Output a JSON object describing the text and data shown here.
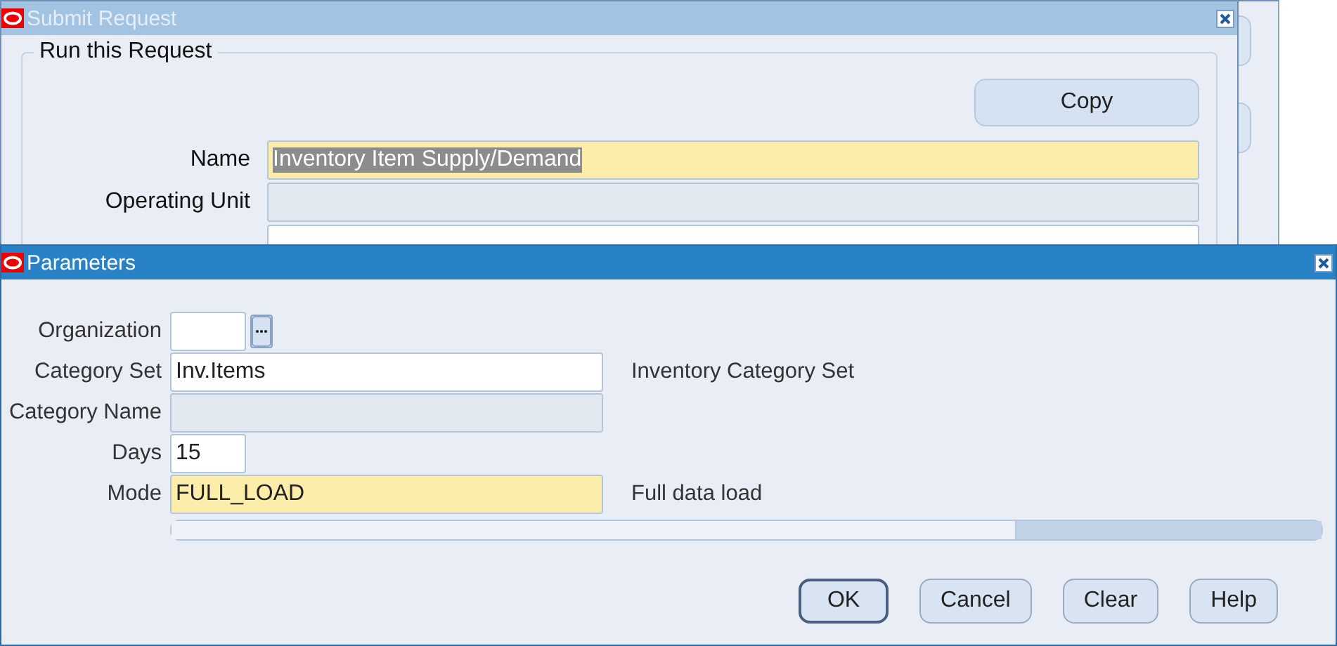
{
  "submit_window": {
    "title": "Submit Request",
    "group_title": "Run this Request",
    "copy_button": "Copy",
    "fields": [
      {
        "label": "Name",
        "value": "Inventory Item Supply/Demand",
        "value_selected": true,
        "required": true,
        "disabled": false
      },
      {
        "label": "Operating Unit",
        "required": false,
        "disabled": true
      },
      {
        "required": false,
        "disabled": false
      }
    ]
  },
  "parameters_window": {
    "title": "Parameters",
    "fields": [
      {
        "label": "Organization",
        "kind": "lov",
        "required": false,
        "disabled": false
      },
      {
        "label": "Category Set",
        "value": "Inv.Items",
        "kind": "text",
        "description": "Inventory Category Set",
        "required": false,
        "disabled": false
      },
      {
        "label": "Category Name",
        "kind": "text",
        "required": false,
        "disabled": true
      },
      {
        "label": "Days",
        "value": "15",
        "kind": "number",
        "required": false,
        "disabled": false
      },
      {
        "label": "Mode",
        "value": "FULL_LOAD",
        "kind": "text",
        "description": "Full data load",
        "required": true,
        "disabled": false
      }
    ],
    "buttons": [
      {
        "label": "OK",
        "default": true
      },
      {
        "label": "Cancel",
        "default": false
      },
      {
        "label": "Clear",
        "default": false
      },
      {
        "label": "Help",
        "default": false
      }
    ]
  }
}
